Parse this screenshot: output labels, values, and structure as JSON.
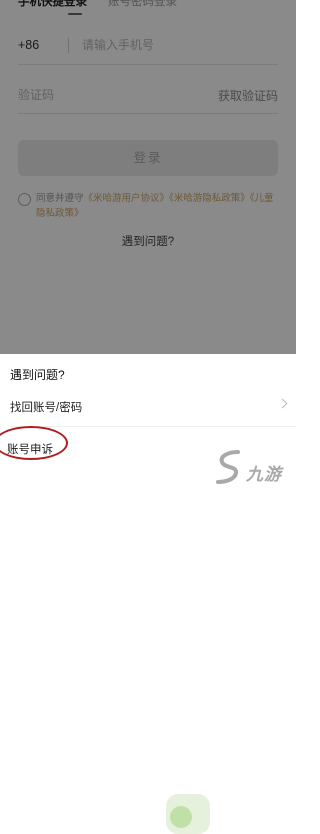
{
  "login_tabs": {
    "active": "手机快捷登录",
    "inactive": "账号密码登录"
  },
  "phone": {
    "country_code": "+86",
    "placeholder": "请输入手机号"
  },
  "code": {
    "placeholder": "验证码",
    "get_code_label": "获取验证码"
  },
  "login_button_label": "登录",
  "agreement": {
    "prefix": "同意并遵守",
    "links": [
      "《米哈游用户协议》",
      "《米哈游隐私政策》",
      "《儿童隐私政策》"
    ]
  },
  "problem_link": "遇到问题?",
  "sheet": {
    "title": "遇到问题?",
    "items": [
      {
        "label": "找回账号/密码"
      },
      {
        "label": "账号申诉"
      }
    ]
  },
  "watermark_text": "九游",
  "colors": {
    "overlay": "rgba(0,0,0,0.46)",
    "link": "#c9a46a",
    "highlight_ellipse": "#b11d1d"
  }
}
